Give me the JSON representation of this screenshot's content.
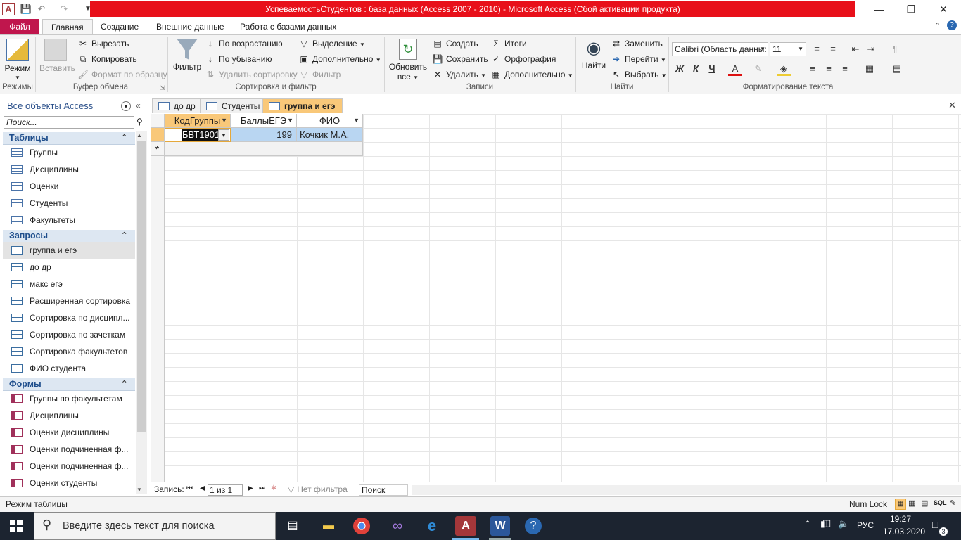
{
  "window": {
    "title": "УспеваемостьСтудентов : база данных (Access 2007 - 2010)  -  Microsoft Access (Сбой активации продукта)",
    "app_icon": "A",
    "minimize": "—",
    "restore": "❐",
    "close": "✕"
  },
  "ribbon_tabs": [
    "Файл",
    "Главная",
    "Создание",
    "Внешние данные",
    "Работа с базами данных"
  ],
  "ribbon": {
    "views": {
      "mode": "Режим",
      "group": "Режимы"
    },
    "clipboard": {
      "paste": "Вставить",
      "cut": "Вырезать",
      "copy": "Копировать",
      "format_painter": "Формат по образцу",
      "group": "Буфер обмена"
    },
    "sort_filter": {
      "filter": "Фильтр",
      "ascending": "По возрастанию",
      "descending": "По убыванию",
      "remove_sort": "Удалить сортировку",
      "selection": "Выделение",
      "advanced": "Дополнительно",
      "toggle_filter": "Фильтр",
      "group": "Сортировка и фильтр"
    },
    "records": {
      "refresh_line1": "Обновить",
      "refresh_line2": "все",
      "new": "Создать",
      "save": "Сохранить",
      "delete": "Удалить",
      "totals": "Итоги",
      "spelling": "Орфография",
      "more": "Дополнительно",
      "group": "Записи"
    },
    "find": {
      "find": "Найти",
      "replace": "Заменить",
      "goto": "Перейти",
      "select": "Выбрать",
      "group": "Найти"
    },
    "text_format": {
      "font": "Calibri (Область данны:",
      "size": "11",
      "bold": "Ж",
      "italic": "К",
      "underline": "Ч",
      "group": "Форматирование текста"
    }
  },
  "nav_pane": {
    "title": "Все объекты Access",
    "search_placeholder": "Поиск...",
    "sections": [
      {
        "label": "Таблицы",
        "items": [
          "Группы",
          "Дисциплины",
          "Оценки",
          "Студенты",
          "Факультеты"
        ]
      },
      {
        "label": "Запросы",
        "items": [
          "группа и егэ",
          "до др",
          "макс егэ",
          "Расширенная сортировка",
          "Сортировка по дисципл...",
          "Сортировка по зачеткам",
          "Сортировка факультетов",
          "ФИО студента"
        ]
      },
      {
        "label": "Формы",
        "items": [
          "Группы по факультетам",
          "Дисциплины",
          "Оценки дисциплины",
          "Оценки подчиненная ф...",
          "Оценки подчиненная ф...",
          "Оценки студенты"
        ]
      }
    ]
  },
  "doc_tabs": [
    "до др",
    "Студенты",
    "группа и егэ"
  ],
  "datasheet": {
    "columns": [
      "КодГруппы",
      "БаллыЕГЭ",
      "ФИО"
    ],
    "rows": [
      [
        "БВТ1901",
        "199",
        "Кочкик М.А."
      ]
    ],
    "new_row_marker": "*"
  },
  "record_nav": {
    "label": "Запись:",
    "position": "1 из 1",
    "filter": "Нет фильтра",
    "search": "Поиск"
  },
  "status": {
    "left": "Режим таблицы",
    "numlock": "Num Lock"
  },
  "taskbar": {
    "search_placeholder": "Введите здесь текст для поиска",
    "lang": "РУС",
    "time": "19:27",
    "date": "17.03.2020",
    "notifications": "3"
  }
}
